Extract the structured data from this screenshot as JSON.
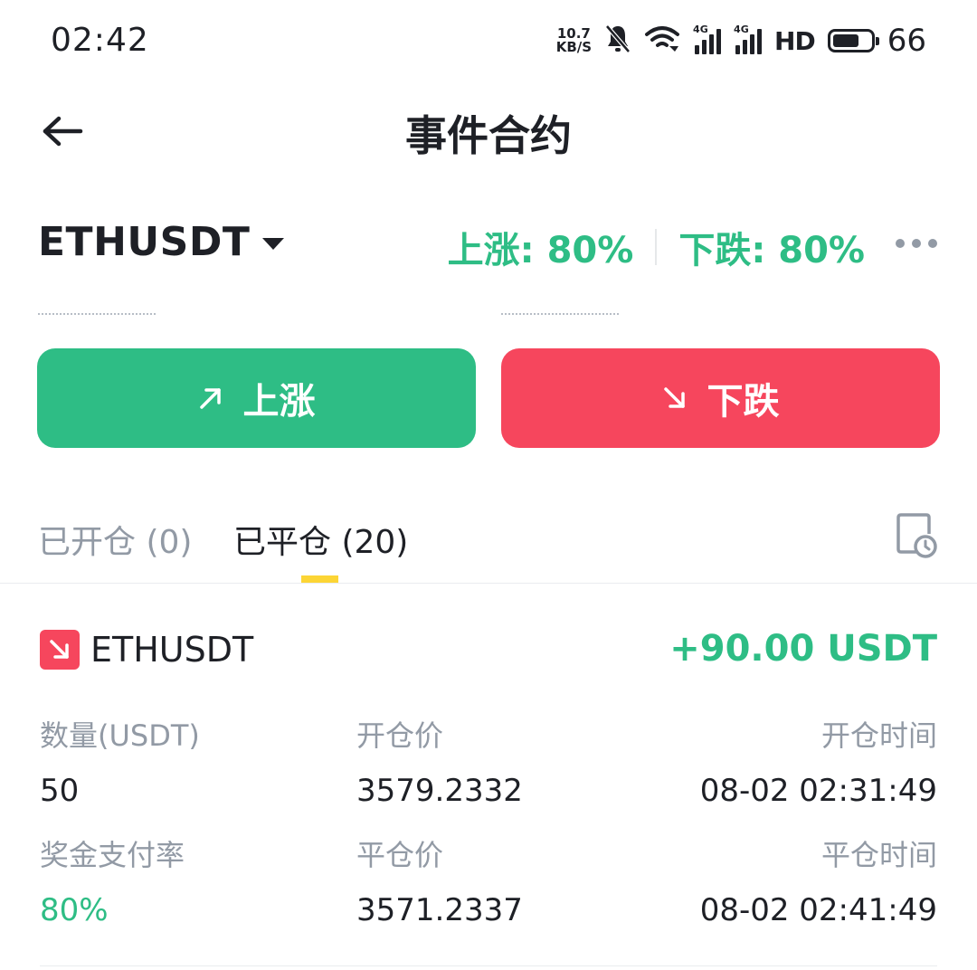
{
  "status_bar": {
    "time": "02:42",
    "net_speed_value": "10.7",
    "net_speed_unit": "KB/S",
    "signal_tag_1": "4G",
    "signal_tag_2": "4G",
    "hd_label": "HD",
    "battery_level": "66"
  },
  "header": {
    "title": "事件合约"
  },
  "pair": {
    "symbol": "ETHUSDT",
    "rate_up": "上涨: 80%",
    "rate_down": "下跌: 80%"
  },
  "actions": {
    "up_label": "上涨",
    "down_label": "下跌"
  },
  "tabs": {
    "open_label": "已开仓 (0)",
    "closed_label": "已平仓 (20)"
  },
  "position": {
    "symbol": "ETHUSDT",
    "pnl": "+90.00 USDT",
    "quantity_label": "数量(USDT)",
    "quantity_value": "50",
    "open_price_label": "开仓价",
    "open_price_value": "3579.2332",
    "open_time_label": "开仓时间",
    "open_time_value": "08-02 02:31:49",
    "payout_label": "奖金支付率",
    "payout_value": "80%",
    "close_price_label": "平仓价",
    "close_price_value": "3571.2337",
    "close_time_label": "平仓时间",
    "close_time_value": "08-02 02:41:49"
  },
  "colors": {
    "up": "#2ebd85",
    "down": "#f6465d",
    "accent": "#fcd535"
  }
}
